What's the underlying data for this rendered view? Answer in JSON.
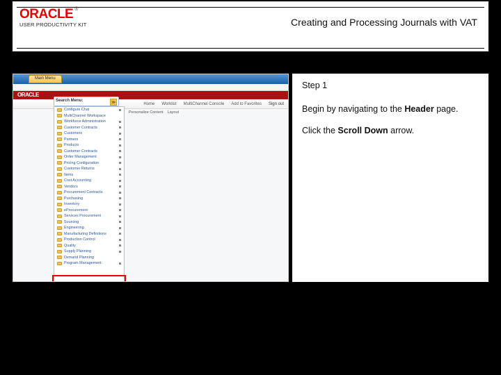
{
  "header": {
    "brand": "ORACLE",
    "tm": "®",
    "subbrand": "USER PRODUCTIVITY KIT",
    "title": "Creating and Processing Journals with VAT"
  },
  "instructions": {
    "step_label": "Step 1",
    "line1_pre": "Begin by navigating to the ",
    "line1_bold": "Header",
    "line1_post": " page.",
    "line2_pre": "Click the ",
    "line2_bold": "Scroll Down",
    "line2_post": " arrow."
  },
  "screenshot": {
    "tab_label": "Main Menu",
    "oracle_word": "ORACLE",
    "nav": {
      "item1": "Home",
      "item2": "Worklist",
      "item3": "MultiChannel Console",
      "item4": "Add to Favorites",
      "item5": "Sign out"
    },
    "search": {
      "label": "Search Menu:",
      "arrow": "≫"
    },
    "personalize": {
      "a": "Personalize Content",
      "b": "Layout"
    },
    "menu": [
      {
        "label": "Configure Chat",
        "expand": true
      },
      {
        "label": "MultiChannel Workspace",
        "expand": false
      },
      {
        "label": "Workforce Administration",
        "expand": true
      },
      {
        "label": "Customer Contracts",
        "expand": true
      },
      {
        "label": "Customers",
        "expand": true
      },
      {
        "label": "Partners",
        "expand": true
      },
      {
        "label": "Products",
        "expand": true
      },
      {
        "label": "Customer Contracts",
        "expand": true
      },
      {
        "label": "Order Management",
        "expand": true
      },
      {
        "label": "Pricing Configuration",
        "expand": true
      },
      {
        "label": "Customer Returns",
        "expand": true
      },
      {
        "label": "Items",
        "expand": true
      },
      {
        "label": "Cost Accounting",
        "expand": true
      },
      {
        "label": "Vendors",
        "expand": true
      },
      {
        "label": "Procurement Contracts",
        "expand": true
      },
      {
        "label": "Purchasing",
        "expand": true
      },
      {
        "label": "Inventory",
        "expand": true
      },
      {
        "label": "eProcurement",
        "expand": true
      },
      {
        "label": "Services Procurement",
        "expand": true
      },
      {
        "label": "Sourcing",
        "expand": true
      },
      {
        "label": "Engineering",
        "expand": true
      },
      {
        "label": "Manufacturing Definitions",
        "expand": true
      },
      {
        "label": "Production Control",
        "expand": true
      },
      {
        "label": "Quality",
        "expand": true
      },
      {
        "label": "Supply Planning",
        "expand": true
      },
      {
        "label": "Demand Planning",
        "expand": false
      },
      {
        "label": "Program Management",
        "expand": true
      }
    ]
  }
}
